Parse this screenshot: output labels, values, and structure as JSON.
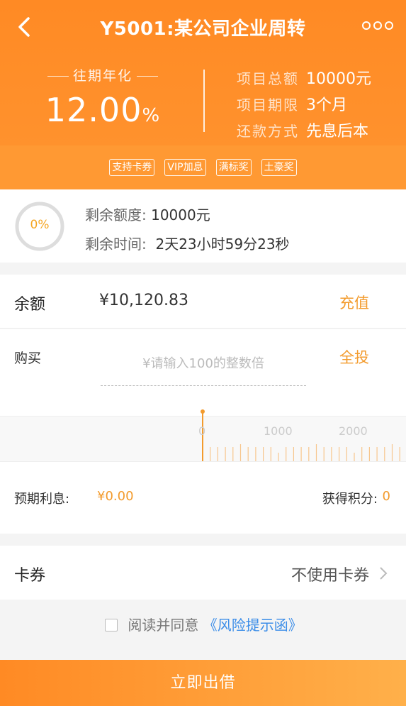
{
  "header": {
    "title": "Y5001:某公司企业周转",
    "back_icon": "chevron-left-icon",
    "more_icon": "more-dots-icon"
  },
  "rate": {
    "label": "往期年化",
    "value": "12.00",
    "unit": "%"
  },
  "project_info": [
    {
      "key": "项目总额",
      "value": "10000元"
    },
    {
      "key": "项目期限",
      "value": "3个月"
    },
    {
      "key": "还款方式",
      "value": "先息后本"
    }
  ],
  "tags": [
    "支持卡券",
    "VIP加息",
    "满标奖",
    "土豪奖"
  ],
  "progress": {
    "percent_label": "0%",
    "percent_value": 0,
    "remaining_amount_key": "剩余额度:",
    "remaining_amount_value": "10000元",
    "remaining_time_key": "剩余时间:",
    "remaining_time_value": "2天23小时59分23秒"
  },
  "balance": {
    "label": "余额",
    "value": "¥10,120.83",
    "recharge_label": "充值"
  },
  "buy": {
    "label": "购买",
    "placeholder": "¥请输入100的整数倍",
    "all_in_label": "全投",
    "ruler_labels": [
      "0",
      "1000",
      "2000"
    ],
    "ruler_value": 0
  },
  "interest": {
    "label": "预期利息:",
    "value": "¥0.00",
    "points_label": "获得积分:",
    "points_value": "0"
  },
  "coupon": {
    "label": "卡券",
    "value": "不使用卡券"
  },
  "agreement": {
    "text": "阅读并同意",
    "link": "《风险提示函》",
    "checked": false
  },
  "submit": {
    "label": "立即出借"
  },
  "colors": {
    "brand_orange": "#ff8a24",
    "accent_text": "#f39b2d",
    "link_blue": "#3d8ee8"
  }
}
